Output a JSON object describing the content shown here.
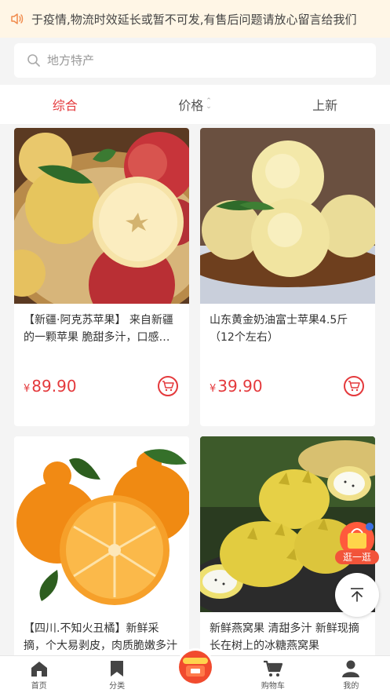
{
  "notice": {
    "text": "于疫情,物流时效延长或暂不可发,有售后问题请放心留言给我们"
  },
  "search": {
    "placeholder": "地方特产"
  },
  "sort": {
    "items": [
      {
        "label": "综合",
        "active": true
      },
      {
        "label": "价格",
        "active": false
      },
      {
        "label": "上新",
        "active": false
      }
    ]
  },
  "products": [
    {
      "title": "【新疆·阿克苏苹果】 来自新疆的一颗苹果 脆甜多汁，口感细腻",
      "currency": "¥",
      "price": "89.90"
    },
    {
      "title": "山东黄金奶油富士苹果4.5斤（12个左右）",
      "currency": "¥",
      "price": "39.90"
    },
    {
      "title": "【四川.不知火丑橘】新鲜采摘，个大易剥皮，肉质脆嫩多汁",
      "currency": "¥",
      "price": ""
    },
    {
      "title": "新鲜燕窝果 清甜多汁 新鲜现摘 长在树上的冰糖燕窝果",
      "currency": "¥",
      "price": ""
    }
  ],
  "float": {
    "go_label": "逛一逛"
  },
  "tabbar": {
    "items": [
      {
        "label": "首页",
        "icon": "home-icon"
      },
      {
        "label": "分类",
        "icon": "bookmark-icon"
      },
      {
        "label": "",
        "icon": "promo-icon"
      },
      {
        "label": "购物车",
        "icon": "cart-icon"
      },
      {
        "label": "我的",
        "icon": "user-icon"
      }
    ]
  },
  "colors": {
    "accent": "#e4393c",
    "notice_bg": "#fff6e6",
    "speaker": "#f08a4b"
  }
}
